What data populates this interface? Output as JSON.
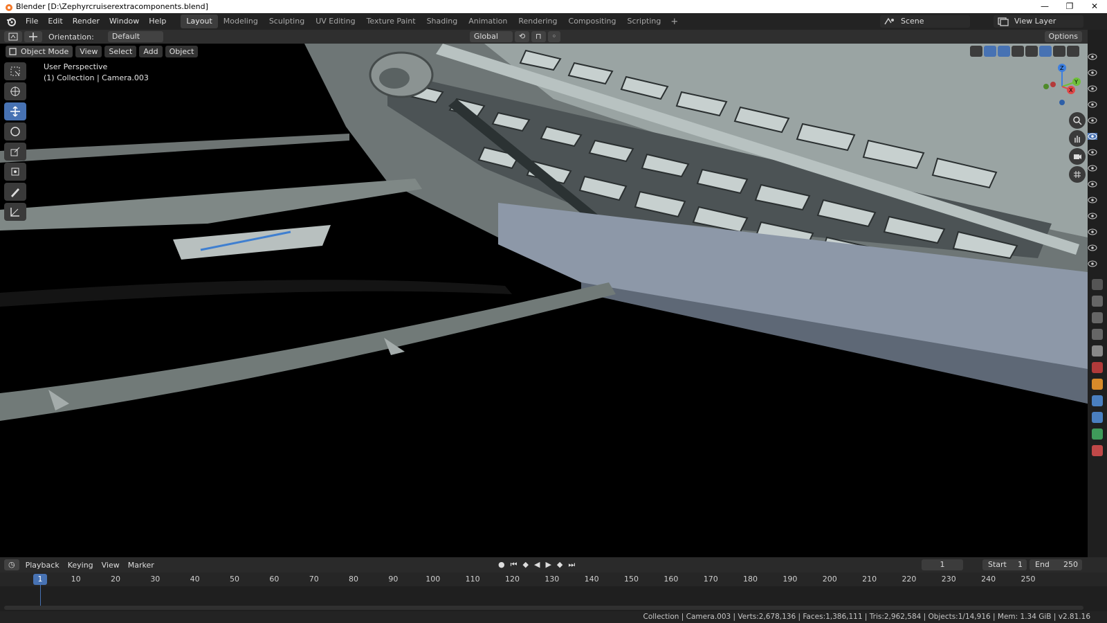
{
  "window": {
    "title": "Blender [D:\\Zephyrcruiserextracomponents.blend]",
    "controls": [
      "—",
      "❐",
      "✕"
    ]
  },
  "menu": [
    "File",
    "Edit",
    "Render",
    "Window",
    "Help"
  ],
  "workspaces": {
    "tabs": [
      "Layout",
      "Modeling",
      "Sculpting",
      "UV Editing",
      "Texture Paint",
      "Shading",
      "Animation",
      "Rendering",
      "Compositing",
      "Scripting"
    ],
    "active": "Layout",
    "add": "+"
  },
  "scene": {
    "name": "Scene"
  },
  "view_layer": {
    "name": "View Layer"
  },
  "tool_header": {
    "orientation_label": "Orientation:",
    "orientation_value": "Default",
    "transform_space": "Global",
    "options": "Options"
  },
  "viewport": {
    "mode": "Object Mode",
    "menus": [
      "View",
      "Select",
      "Add",
      "Object"
    ],
    "perspective": "User Perspective",
    "collection_info": "(1) Collection | Camera.003",
    "gizmo_axes": [
      "Z",
      "Y",
      "X"
    ]
  },
  "timeline": {
    "menus": [
      "Playback",
      "Keying",
      "View",
      "Marker"
    ],
    "current_frame": "1",
    "start_label": "Start",
    "start_value": "1",
    "end_label": "End",
    "end_value": "250",
    "ticks": [
      "10",
      "20",
      "30",
      "40",
      "50",
      "60",
      "70",
      "80",
      "90",
      "100",
      "110",
      "120",
      "130",
      "140",
      "150",
      "160",
      "170",
      "180",
      "190",
      "200",
      "210",
      "220",
      "230",
      "240",
      "250"
    ]
  },
  "status": {
    "stats": "Collection | Camera.003 | Verts:2,678,136 | Faces:1,386,111 | Tris:2,962,584 | Objects:1/14,916 | Mem: 1.34 GiB | v2.81.16"
  },
  "colors": {
    "accent": "#4772b3",
    "background": "#1d1d1d",
    "viewport": "#000000"
  }
}
